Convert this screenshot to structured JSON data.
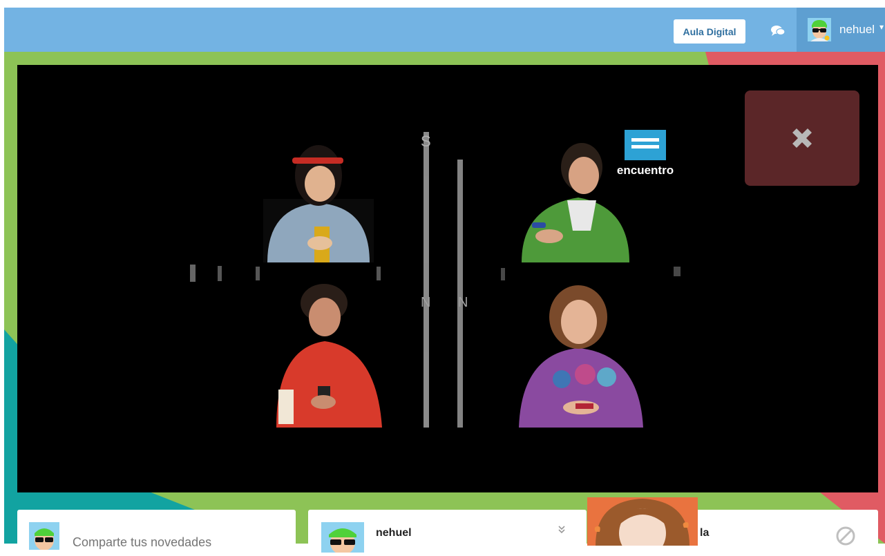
{
  "navbar": {
    "aula_button": "Aula Digital",
    "chat_icon": "chat-bubbles-icon",
    "user": {
      "name": "nehuel",
      "avatar_icon": "user-avatar-sunglasses",
      "caret_icon": "caret-down-icon"
    }
  },
  "video": {
    "channel_logo": "encuentro",
    "close_icon": "close-x-icon"
  },
  "cards": {
    "compose": {
      "placeholder": "Comparte tus novedades"
    },
    "post": {
      "author": "nehuel",
      "menu_icon": "double-chevron-down-icon"
    },
    "third": {
      "author_partial": "la",
      "action_icon": "ban-icon"
    }
  },
  "colors": {
    "navbar": "#73b3e3",
    "navbar_user": "#5e9fd1",
    "bg_green": "#8dc356",
    "bg_red": "#e05b63",
    "bg_teal": "#12a3a1",
    "close_overlay": "#5b2628"
  }
}
